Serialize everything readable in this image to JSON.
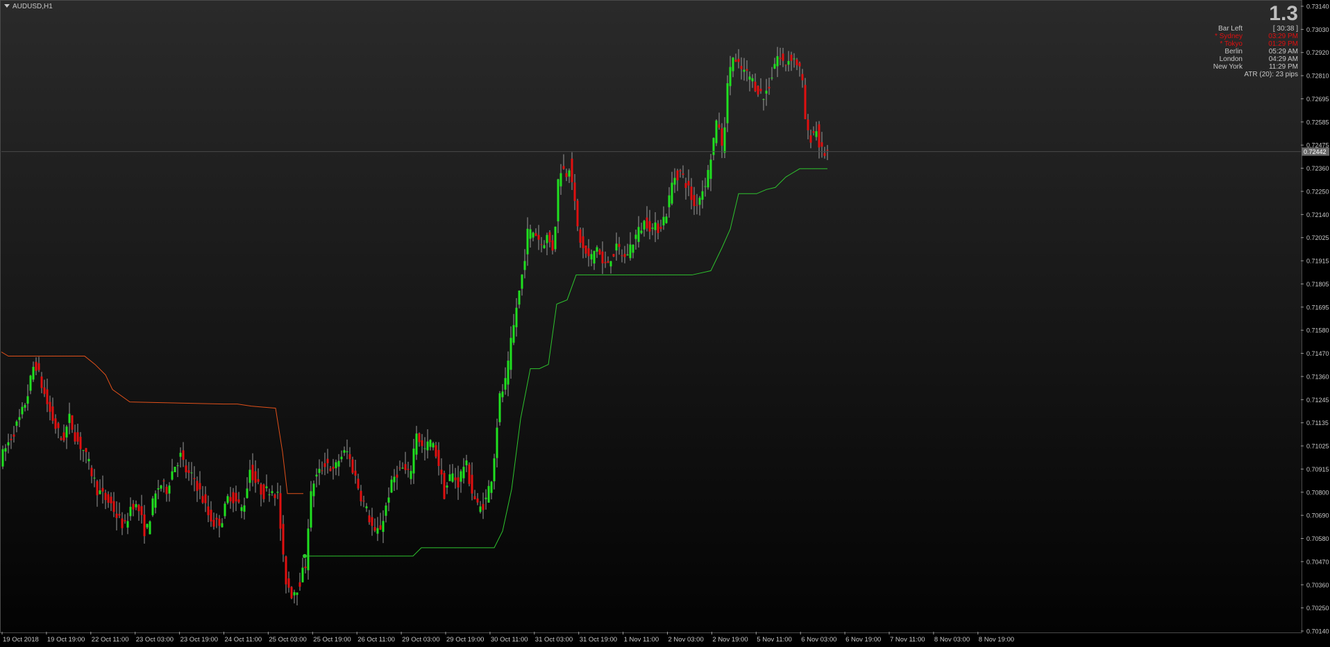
{
  "chart_data": {
    "type": "candlestick",
    "symbol": "AUDUSD,H1",
    "price_ticks": [
      "0.73140",
      "0.73030",
      "0.72920",
      "0.72810",
      "0.72695",
      "0.72585",
      "0.72475",
      "0.72360",
      "0.72250",
      "0.72140",
      "0.72025",
      "0.71915",
      "0.71805",
      "0.71695",
      "0.71580",
      "0.71470",
      "0.71360",
      "0.71245",
      "0.71135",
      "0.71025",
      "0.70915",
      "0.70800",
      "0.70690",
      "0.70580",
      "0.70470",
      "0.70360",
      "0.70250",
      "0.70140"
    ],
    "time_ticks": [
      "19 Oct 2018",
      "19 Oct 19:00",
      "22 Oct 11:00",
      "23 Oct 03:00",
      "23 Oct 19:00",
      "24 Oct 11:00",
      "25 Oct 03:00",
      "25 Oct 19:00",
      "26 Oct 11:00",
      "29 Oct 03:00",
      "29 Oct 19:00",
      "30 Oct 11:00",
      "31 Oct 03:00",
      "31 Oct 19:00",
      "1 Nov 11:00",
      "2 Nov 03:00",
      "2 Nov 19:00",
      "5 Nov 11:00",
      "6 Nov 03:00",
      "6 Nov 19:00",
      "7 Nov 11:00",
      "8 Nov 03:00",
      "8 Nov 19:00"
    ],
    "current_price": "0.72442",
    "ylim": [
      0.7014,
      0.7314
    ],
    "price_path": [
      [
        0,
        0.7096
      ],
      [
        10,
        0.7103
      ],
      [
        20,
        0.711
      ],
      [
        30,
        0.7117
      ],
      [
        40,
        0.7128
      ],
      [
        50,
        0.7144
      ],
      [
        60,
        0.7132
      ],
      [
        70,
        0.7121
      ],
      [
        80,
        0.7112
      ],
      [
        90,
        0.7105
      ],
      [
        100,
        0.7116
      ],
      [
        110,
        0.7106
      ],
      [
        120,
        0.7101
      ],
      [
        130,
        0.7092
      ],
      [
        140,
        0.7082
      ],
      [
        150,
        0.7078
      ],
      [
        160,
        0.7075
      ],
      [
        170,
        0.7068
      ],
      [
        180,
        0.7064
      ],
      [
        190,
        0.7076
      ],
      [
        200,
        0.7072
      ],
      [
        210,
        0.706
      ],
      [
        220,
        0.7075
      ],
      [
        230,
        0.7085
      ],
      [
        240,
        0.7082
      ],
      [
        250,
        0.7093
      ],
      [
        260,
        0.7098
      ],
      [
        270,
        0.7089
      ],
      [
        280,
        0.7087
      ],
      [
        290,
        0.7079
      ],
      [
        300,
        0.707
      ],
      [
        310,
        0.7065
      ],
      [
        320,
        0.7068
      ],
      [
        330,
        0.708
      ],
      [
        340,
        0.7076
      ],
      [
        350,
        0.7072
      ],
      [
        360,
        0.7092
      ],
      [
        370,
        0.7084
      ],
      [
        380,
        0.708
      ],
      [
        390,
        0.7083
      ],
      [
        400,
        0.7079
      ],
      [
        405,
        0.706
      ],
      [
        410,
        0.704
      ],
      [
        420,
        0.7032
      ],
      [
        430,
        0.7036
      ],
      [
        440,
        0.7046
      ],
      [
        445,
        0.707
      ],
      [
        450,
        0.7085
      ],
      [
        460,
        0.709
      ],
      [
        470,
        0.7096
      ],
      [
        480,
        0.709
      ],
      [
        490,
        0.7098
      ],
      [
        500,
        0.71
      ],
      [
        510,
        0.709
      ],
      [
        520,
        0.7079
      ],
      [
        530,
        0.707
      ],
      [
        540,
        0.706
      ],
      [
        550,
        0.7065
      ],
      [
        560,
        0.708
      ],
      [
        570,
        0.709
      ],
      [
        580,
        0.7092
      ],
      [
        590,
        0.7088
      ],
      [
        600,
        0.711
      ],
      [
        610,
        0.71
      ],
      [
        620,
        0.7105
      ],
      [
        630,
        0.7098
      ],
      [
        640,
        0.708
      ],
      [
        650,
        0.709
      ],
      [
        660,
        0.7085
      ],
      [
        670,
        0.7096
      ],
      [
        680,
        0.7081
      ],
      [
        690,
        0.7072
      ],
      [
        700,
        0.7077
      ],
      [
        710,
        0.7091
      ],
      [
        715,
        0.711
      ],
      [
        720,
        0.7126
      ],
      [
        730,
        0.7135
      ],
      [
        735,
        0.715
      ],
      [
        740,
        0.716
      ],
      [
        745,
        0.7172
      ],
      [
        750,
        0.718
      ],
      [
        755,
        0.7192
      ],
      [
        760,
        0.7205
      ],
      [
        770,
        0.7206
      ],
      [
        780,
        0.72
      ],
      [
        790,
        0.7204
      ],
      [
        795,
        0.7195
      ],
      [
        800,
        0.721
      ],
      [
        805,
        0.7235
      ],
      [
        810,
        0.7237
      ],
      [
        815,
        0.7233
      ],
      [
        820,
        0.7238
      ],
      [
        825,
        0.723
      ],
      [
        830,
        0.721
      ],
      [
        835,
        0.7203
      ],
      [
        840,
        0.7197
      ],
      [
        850,
        0.7192
      ],
      [
        860,
        0.7199
      ],
      [
        870,
        0.7188
      ],
      [
        880,
        0.7194
      ],
      [
        890,
        0.7198
      ],
      [
        900,
        0.7193
      ],
      [
        910,
        0.72
      ],
      [
        920,
        0.7206
      ],
      [
        930,
        0.7211
      ],
      [
        940,
        0.7207
      ],
      [
        950,
        0.7208
      ],
      [
        960,
        0.7215
      ],
      [
        970,
        0.7232
      ],
      [
        980,
        0.7234
      ],
      [
        990,
        0.7228
      ],
      [
        1000,
        0.7218
      ],
      [
        1010,
        0.7224
      ],
      [
        1020,
        0.7234
      ],
      [
        1030,
        0.7254
      ],
      [
        1035,
        0.726
      ],
      [
        1040,
        0.7245
      ],
      [
        1045,
        0.7262
      ],
      [
        1050,
        0.7283
      ],
      [
        1055,
        0.729
      ],
      [
        1060,
        0.7286
      ],
      [
        1070,
        0.7283
      ],
      [
        1080,
        0.728
      ],
      [
        1090,
        0.7275
      ],
      [
        1100,
        0.727
      ],
      [
        1110,
        0.7278
      ],
      [
        1115,
        0.7286
      ],
      [
        1120,
        0.729
      ],
      [
        1130,
        0.7286
      ],
      [
        1140,
        0.729
      ],
      [
        1150,
        0.7286
      ],
      [
        1155,
        0.728
      ],
      [
        1160,
        0.726
      ],
      [
        1165,
        0.725
      ],
      [
        1170,
        0.7252
      ],
      [
        1175,
        0.7256
      ],
      [
        1180,
        0.7248
      ],
      [
        1185,
        0.7243
      ],
      [
        1190,
        0.7244
      ]
    ],
    "supertrend_down": [
      [
        0,
        0.7148
      ],
      [
        10,
        0.7146
      ],
      [
        120,
        0.7146
      ],
      [
        135,
        0.7142
      ],
      [
        150,
        0.7137
      ],
      [
        160,
        0.713
      ],
      [
        185,
        0.7124
      ],
      [
        320,
        0.7123
      ],
      [
        340,
        0.7123
      ],
      [
        360,
        0.7122
      ],
      [
        395,
        0.7121
      ],
      [
        405,
        0.71
      ],
      [
        412,
        0.708
      ],
      [
        435,
        0.708
      ]
    ],
    "supertrend_up": [
      [
        437,
        0.705
      ],
      [
        593,
        0.705
      ],
      [
        605,
        0.7054
      ],
      [
        710,
        0.7054
      ],
      [
        722,
        0.7062
      ],
      [
        735,
        0.7082
      ],
      [
        748,
        0.7116
      ],
      [
        762,
        0.714
      ],
      [
        775,
        0.714
      ],
      [
        788,
        0.7142
      ],
      [
        800,
        0.7171
      ],
      [
        815,
        0.7173
      ],
      [
        828,
        0.7185
      ],
      [
        995,
        0.7185
      ],
      [
        1022,
        0.7187
      ],
      [
        1038,
        0.7198
      ],
      [
        1050,
        0.7207
      ],
      [
        1062,
        0.7224
      ],
      [
        1088,
        0.7224
      ],
      [
        1102,
        0.7226
      ],
      [
        1115,
        0.7227
      ],
      [
        1130,
        0.7232
      ],
      [
        1150,
        0.7236
      ],
      [
        1190,
        0.7236
      ]
    ]
  },
  "info_panel": {
    "value": "1.3",
    "rows": [
      {
        "label": "Bar Left",
        "value": "[ 30:38 ]",
        "highlight": false
      },
      {
        "label": "* Sydney",
        "value": "03:29 PM",
        "highlight": true
      },
      {
        "label": "* Tokyo",
        "value": "01:29 PM",
        "highlight": true
      },
      {
        "label": "Berlin",
        "value": "05:29 AM",
        "highlight": false
      },
      {
        "label": "London",
        "value": "04:29 AM",
        "highlight": false
      },
      {
        "label": "New York",
        "value": "11:29 PM",
        "highlight": false
      }
    ],
    "atr": "ATR (20): 23 pips"
  },
  "colors": {
    "bull": "#20e020",
    "bear": "#e01010",
    "supertrend_up": "#2ec42e",
    "supertrend_down": "#e0501a",
    "highlight": "#e01010"
  }
}
